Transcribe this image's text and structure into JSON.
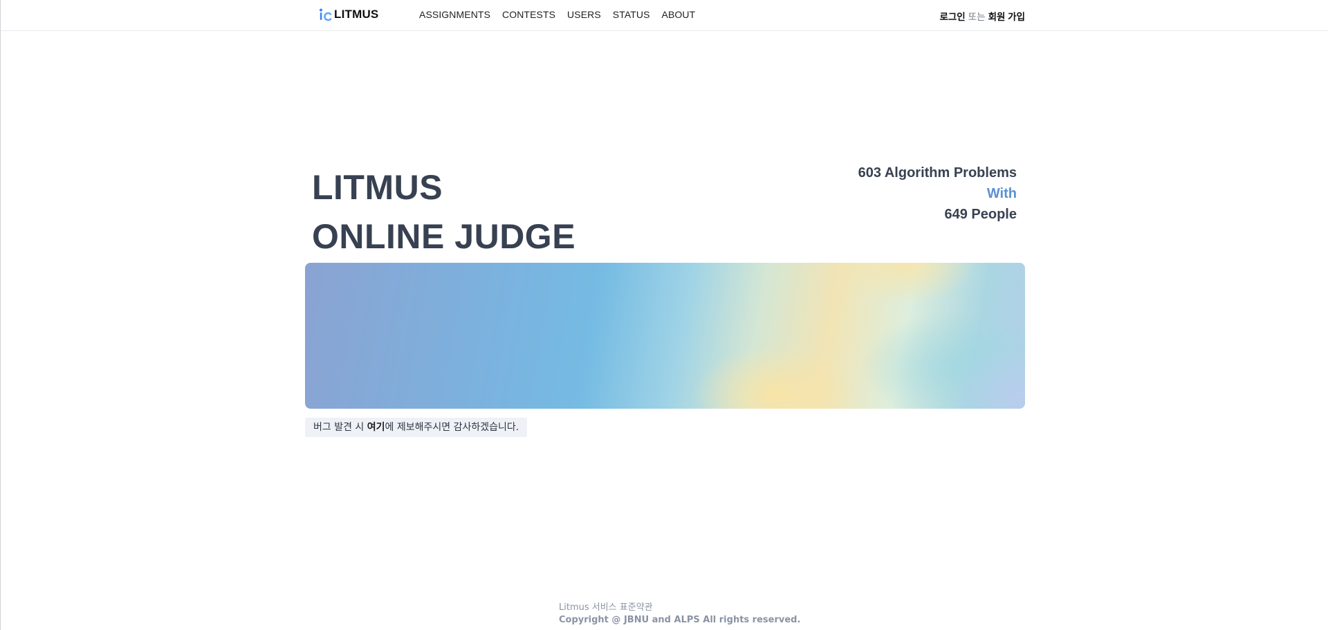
{
  "header": {
    "logo_text": "LITMUS",
    "nav": [
      {
        "label": "ASSIGNMENTS"
      },
      {
        "label": "CONTESTS"
      },
      {
        "label": "USERS"
      },
      {
        "label": "STATUS"
      },
      {
        "label": "ABOUT"
      }
    ],
    "auth": {
      "login": "로그인",
      "or": "또는",
      "signup": "회원 가입"
    }
  },
  "hero": {
    "title_line1": "LITMUS",
    "title_line2": "ONLINE JUDGE",
    "stats_line1": "603 Algorithm Problems",
    "stats_line2": "With",
    "stats_line3": "649 People"
  },
  "notice": {
    "prefix": "버그 발견 시 ",
    "link": "여기",
    "suffix": "에 제보해주시면 감사하겠습니다."
  },
  "footer": {
    "line1": "Litmus 서비스 표준약관",
    "line2": "Copyright @ JBNU and ALPS All rights reserved."
  },
  "colors": {
    "accent_with": "#5b8fd4",
    "title_text": "#374151",
    "notice_bg": "#eef1f6"
  },
  "icons": {
    "logo": "litmus-logo-icon"
  }
}
